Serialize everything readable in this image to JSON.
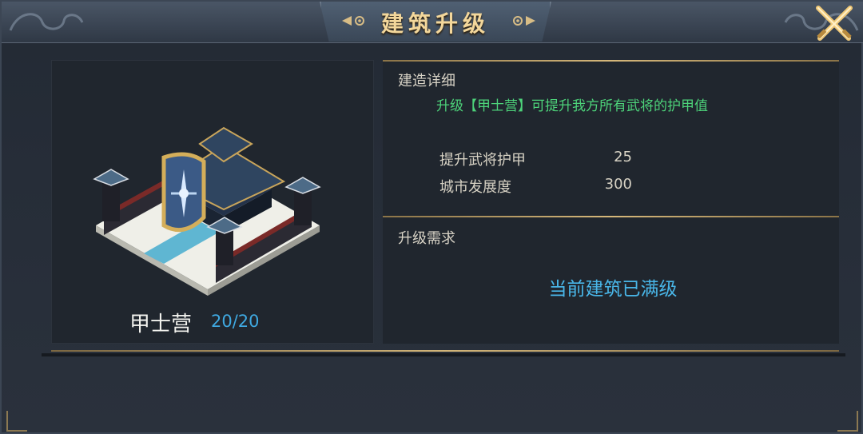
{
  "header": {
    "title": "建筑升级",
    "close_icon": "close-swords-icon"
  },
  "building": {
    "name": "甲士营",
    "level": "20/20",
    "image": "barracks-building-illustration"
  },
  "details": {
    "section_title": "建造详细",
    "description": "升级【甲士营】可提升我方所有武将的护甲值",
    "stats": [
      {
        "label": "提升武将护甲",
        "value": "25"
      },
      {
        "label": "城市发展度",
        "value": "300"
      }
    ]
  },
  "requirements": {
    "section_title": "升级需求",
    "status": "当前建筑已满级"
  },
  "colors": {
    "gold": "#d5b77a",
    "green_text": "#4dd37a",
    "blue_text": "#49b6e8",
    "panel": "#20262e"
  }
}
